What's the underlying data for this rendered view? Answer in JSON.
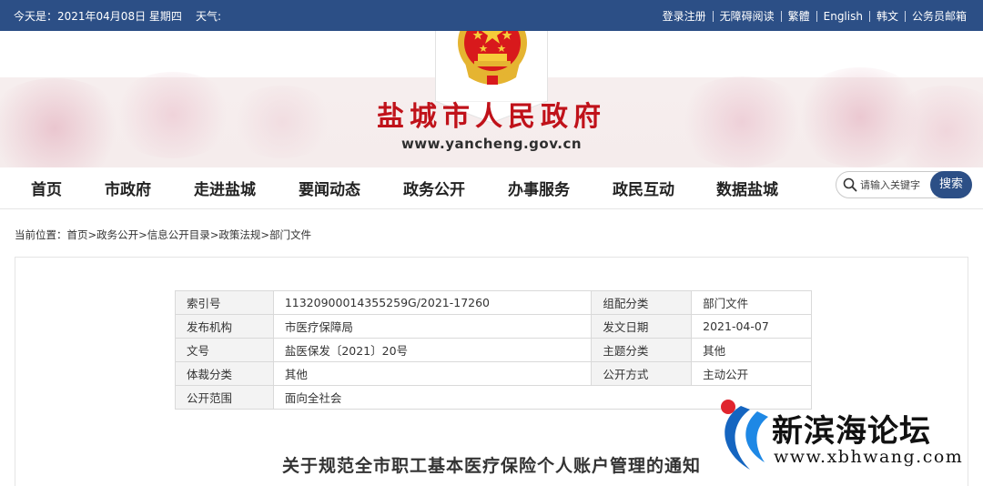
{
  "topbar": {
    "date": "今天是：2021年04月08日 星期四",
    "weather": "天气:",
    "links": [
      "登录注册",
      "无障碍阅读",
      "繁體",
      "English",
      "韩文",
      "公务员邮箱"
    ]
  },
  "header": {
    "title": "盐城市人民政府",
    "url": "www.yancheng.gov.cn"
  },
  "nav": {
    "items": [
      "首页",
      "市政府",
      "走进盐城",
      "要闻动态",
      "政务公开",
      "办事服务",
      "政民互动",
      "数据盐城"
    ],
    "search_placeholder": "请输入关键字",
    "search_button": "搜索"
  },
  "breadcrumb": {
    "label": "当前位置：",
    "items": [
      "首页",
      "政务公开",
      "信息公开目录",
      "政策法规",
      "部门文件"
    ],
    "separator": ">"
  },
  "meta": {
    "rows": [
      [
        "索引号",
        "11320900014355259G/2021-17260",
        "组配分类",
        "部门文件"
      ],
      [
        "发布机构",
        "市医疗保障局",
        "发文日期",
        "2021-04-07"
      ],
      [
        "文号",
        "盐医保发〔2021〕20号",
        "主题分类",
        "其他"
      ],
      [
        "体裁分类",
        "其他",
        "公开方式",
        "主动公开"
      ],
      [
        "公开范围",
        "面向全社会"
      ]
    ]
  },
  "document": {
    "title": "关于规范全市职工基本医疗保险个人账户管理的通知"
  },
  "watermark": {
    "cn": "新滨海论坛",
    "en": "www.xbhwang.com"
  },
  "colors": {
    "topbar": "#2c4f86",
    "title_red": "#c0121a",
    "search_button": "#2c4f86"
  }
}
